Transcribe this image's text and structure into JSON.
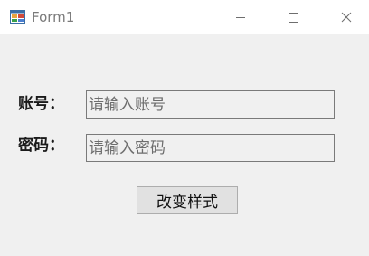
{
  "window": {
    "title": "Form1",
    "icon": "winforms-app-icon",
    "controls": {
      "minimize": "minimize-icon",
      "maximize": "maximize-icon",
      "close": "close-icon"
    }
  },
  "form": {
    "account": {
      "label": "账号：",
      "value": "",
      "placeholder": "请输入账号"
    },
    "password": {
      "label": "密码：",
      "value": "",
      "placeholder": "请输入密码"
    },
    "change_style_button": {
      "label": "改变样式"
    }
  },
  "colors": {
    "form_background": "#f0f0f0",
    "titlebar_background": "#ffffff",
    "input_border": "#7a7a7a",
    "button_background": "#e1e1e1",
    "button_border": "#adadad"
  }
}
